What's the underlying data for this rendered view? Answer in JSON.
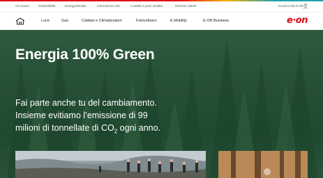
{
  "brand": {
    "logo_text": "e·on",
    "colors": {
      "red": "#e30613",
      "yellow": "#f9b000",
      "teal": "#1ea2b1"
    }
  },
  "topbar": {
    "links": [
      "Chi siamo",
      "Sostenibilità",
      "Energy4People",
      "Informazioni utili",
      "Contatti e punti vendita",
      "Diventa Cliente"
    ],
    "account_label": "Accedi a My E.ON",
    "account_icon": "user-icon"
  },
  "mainnav": {
    "home_icon": "home-icon",
    "items": [
      "Luce",
      "Gas",
      "Caldaie e Climatizzatori",
      "Fotovoltaico",
      "E.Mobility",
      "E.ON Business"
    ]
  },
  "hero": {
    "title": "Energia 100% Green",
    "line1": "Fai parte anche tu del cambiamento.",
    "line2": "Insieme evitiamo l’emissione di 99",
    "line3_before": "milioni di tonnellate di CO",
    "line3_sub": "2",
    "line3_after": " ogni anno."
  },
  "cards": [
    {
      "image": "people-outdoors-photo"
    },
    {
      "image": "forest-photo"
    }
  ]
}
